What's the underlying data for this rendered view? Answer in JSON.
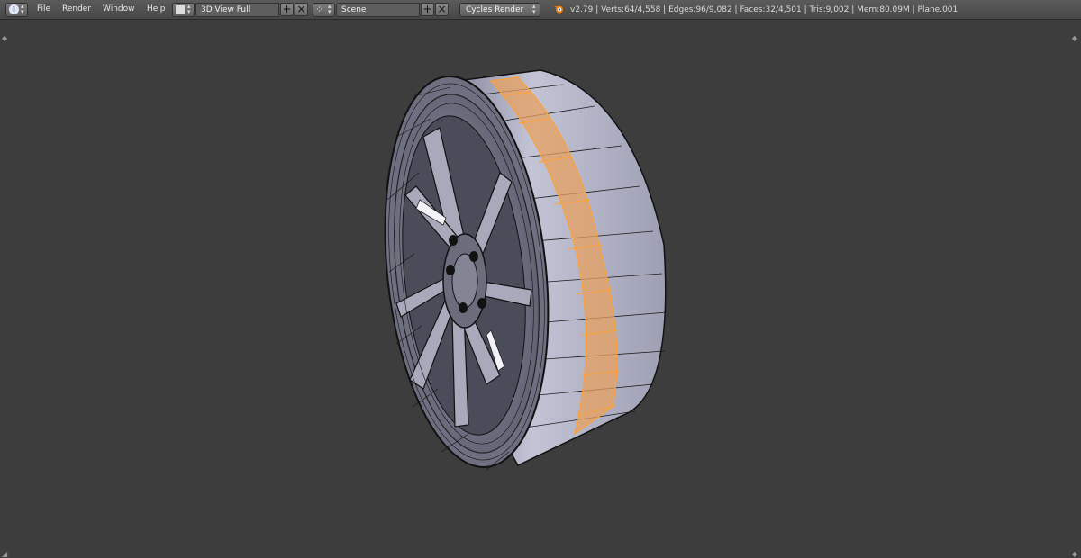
{
  "menubar": {
    "items": [
      "File",
      "Render",
      "Window",
      "Help"
    ]
  },
  "screen_layout": {
    "value": "3D View Full"
  },
  "scene": {
    "value": "Scene"
  },
  "render_engine": {
    "value": "Cycles Render"
  },
  "info_stats": "v2.79 | Verts:64/4,558 | Edges:96/9,082 | Faces:32/4,501 | Tris:9,002 | Mem:80.09M | Plane.001",
  "colors": {
    "background": "#3d3d3d",
    "header": "#4f4f4f",
    "selection": "#ffa033",
    "mesh": "#b7b8c8"
  },
  "icons": {
    "info": "info-icon",
    "layout": "screen-layout-icon",
    "scene": "scene-icon",
    "add": "plus-icon",
    "remove": "x-icon",
    "blender": "blender-logo-icon"
  }
}
